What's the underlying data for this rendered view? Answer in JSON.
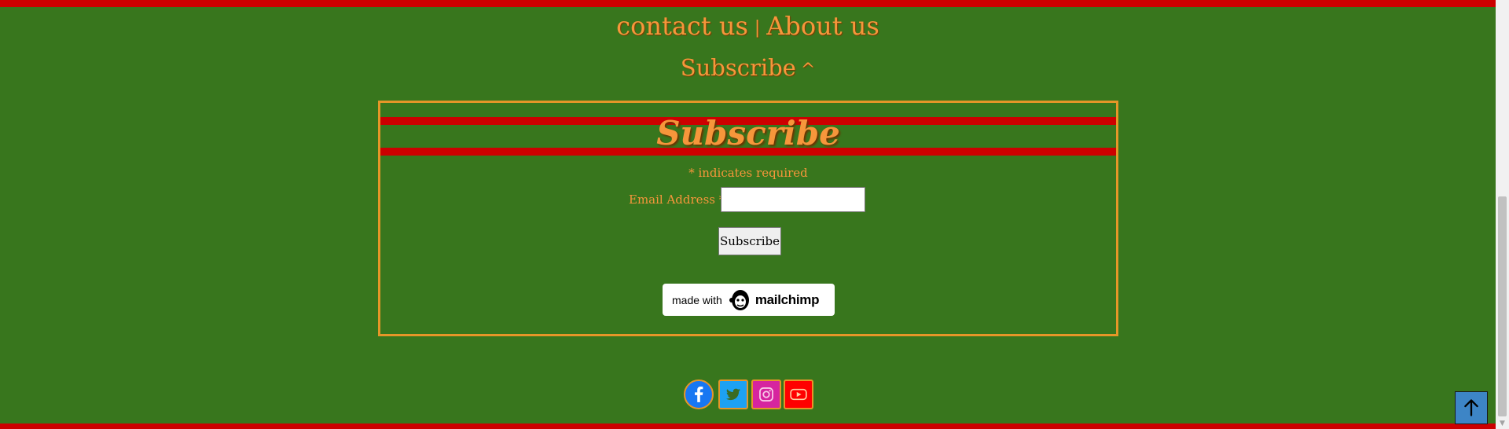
{
  "footer_links": {
    "contact_label": "contact us",
    "separator": "|",
    "about_label": "About us"
  },
  "subscribe_toggle": {
    "label": "Subscribe",
    "chevron": "^"
  },
  "form": {
    "title": "Subscribe",
    "required_note": "* indicates required",
    "email_label": "Email Address *",
    "email_value": "",
    "submit_label": "Subscribe",
    "badge": {
      "made_with": "made with",
      "brand": "mailchimp"
    }
  },
  "social": [
    "facebook-icon",
    "twitter-icon",
    "instagram-icon",
    "youtube-icon"
  ],
  "colors": {
    "background": "#38761d",
    "accent_red": "#cc0000",
    "text_orange": "#f6963b",
    "border_orange": "#e69628",
    "back_to_top": "#3d85c6"
  }
}
